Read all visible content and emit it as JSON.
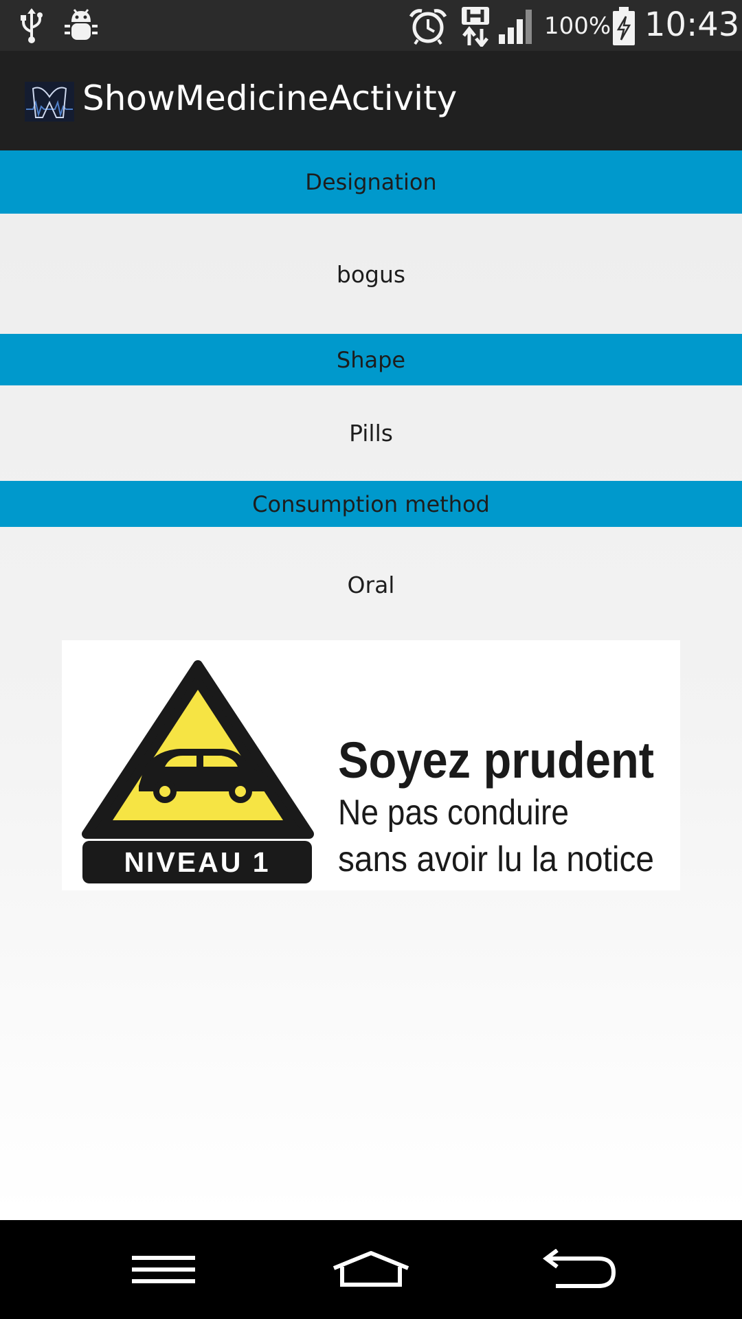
{
  "status_bar": {
    "icons": [
      "usb-icon",
      "debug-bug-icon",
      "alarm-clock-icon",
      "hspa-data-icon",
      "signal-strength-icon",
      "battery-charging-icon"
    ],
    "battery_percent": "100%",
    "time": "10:43"
  },
  "action_bar": {
    "icon": "app-logo-icon",
    "title": "ShowMedicineActivity"
  },
  "medicine": {
    "designation_label": "Designation",
    "designation_value": "bogus",
    "shape_label": "Shape",
    "shape_value": "Pills",
    "consumption_label": "Consumption method",
    "consumption_value": "Oral"
  },
  "warning": {
    "level_label": "NIVEAU 1",
    "headline": "Soyez prudent",
    "line1": "Ne pas conduire",
    "line2": "sans avoir lu la notice",
    "colors": {
      "triangle_fill": "#f6e444",
      "triangle_border": "#1a1a1a",
      "badge_bg": "#1a1a1a"
    }
  },
  "nav_bar": {
    "icons": [
      "menu-icon",
      "home-icon",
      "back-icon"
    ]
  },
  "colors": {
    "accent": "#0099cc",
    "action_bar": "#202020",
    "status_bar": "#2b2b2b"
  }
}
